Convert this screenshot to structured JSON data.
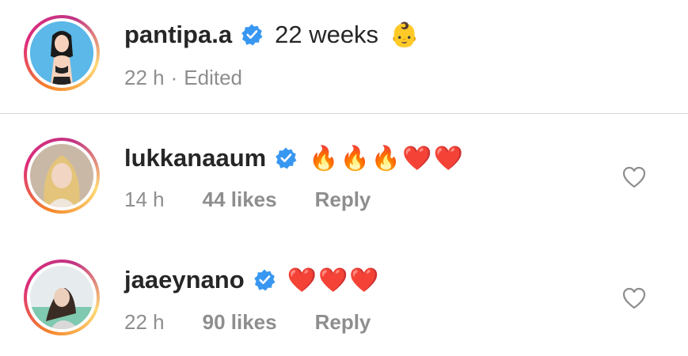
{
  "caption": {
    "username": "pantipa.a",
    "text": "22 weeks",
    "emoji": "👶",
    "time": "22 h",
    "edited": "Edited"
  },
  "comments": [
    {
      "username": "lukkanaaum",
      "emojis": "🔥🔥🔥❤️❤️",
      "time": "14 h",
      "likes": "44 likes",
      "reply": "Reply"
    },
    {
      "username": "jaaeynano",
      "emojis": "❤️❤️❤️",
      "time": "22 h",
      "likes": "90 likes",
      "reply": "Reply"
    }
  ],
  "meta_separator": "·",
  "icons": [
    "verified-badge-icon",
    "heart-outline-icon"
  ],
  "colors": {
    "verified": "#3897f0",
    "text": "#262626",
    "muted": "#8e8e8e",
    "divider": "#dbdbdb"
  }
}
